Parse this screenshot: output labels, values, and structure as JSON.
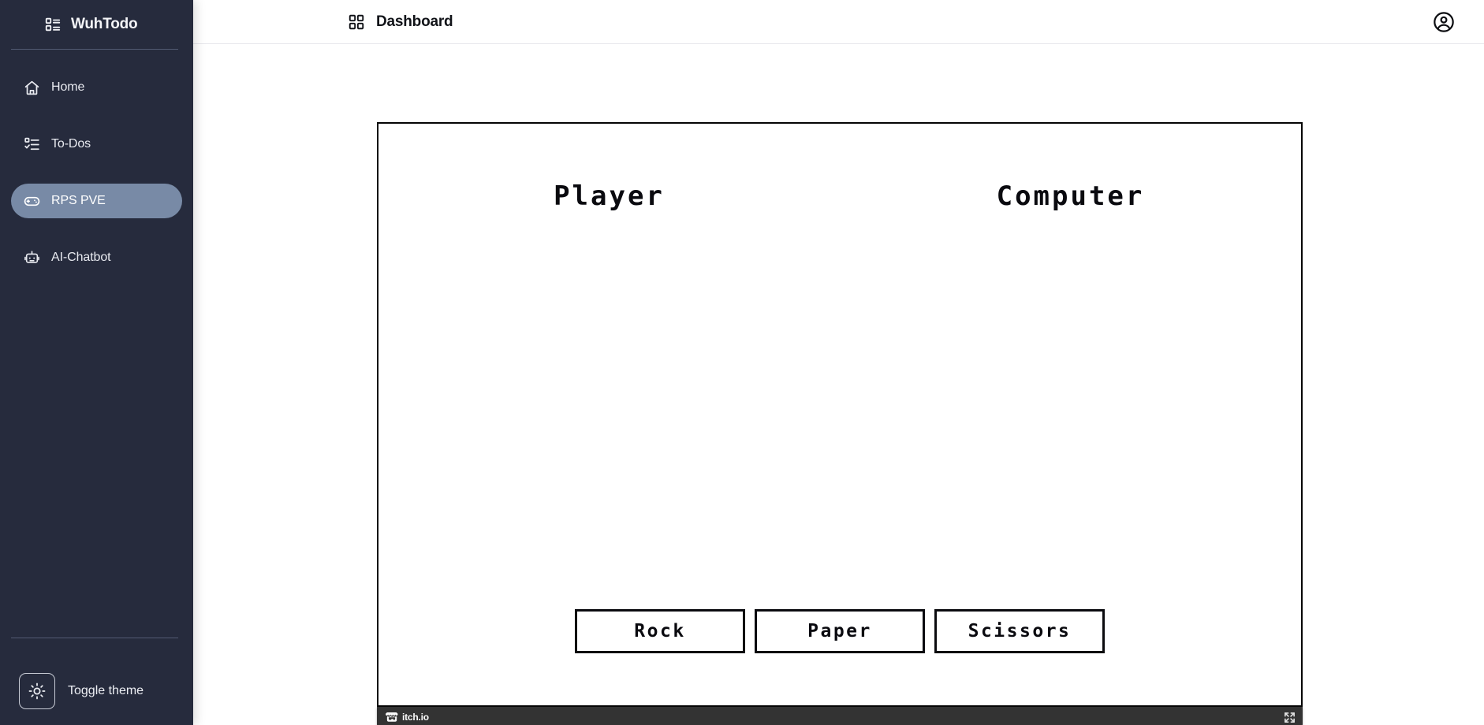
{
  "app": {
    "brand_name": "WuhTodo",
    "brand_icon": "layout-list-icon"
  },
  "sidebar": {
    "items": [
      {
        "label": "Home",
        "icon": "home-icon",
        "active": false
      },
      {
        "label": "To-Dos",
        "icon": "list-check-icon",
        "active": false
      },
      {
        "label": "RPS PVE",
        "icon": "gamepad-icon",
        "active": true
      },
      {
        "label": "AI-Chatbot",
        "icon": "robot-icon",
        "active": false
      }
    ],
    "footer": {
      "theme_label": "Toggle theme",
      "theme_icon": "sun-icon"
    },
    "colors": {
      "background": "#262b3d",
      "active_pill": "#788aa6",
      "text": "#e8eaf0",
      "divider": "#525a73"
    }
  },
  "header": {
    "icon": "dashboard-grid-icon",
    "title": "Dashboard",
    "account_icon": "user-circle-icon"
  },
  "game": {
    "player_label": "Player",
    "computer_label": "Computer",
    "choices": [
      {
        "label": "Rock"
      },
      {
        "label": "Paper"
      },
      {
        "label": "Scissors"
      }
    ],
    "colors": {
      "frame_border": "#050505",
      "stage_background": "#ffffff",
      "text": "#0a0a0f"
    }
  },
  "itch_bar": {
    "logo_icon": "itch-io-logo-icon",
    "label": "itch.io",
    "fullscreen_icon": "fullscreen-icon",
    "background": "#333333"
  }
}
